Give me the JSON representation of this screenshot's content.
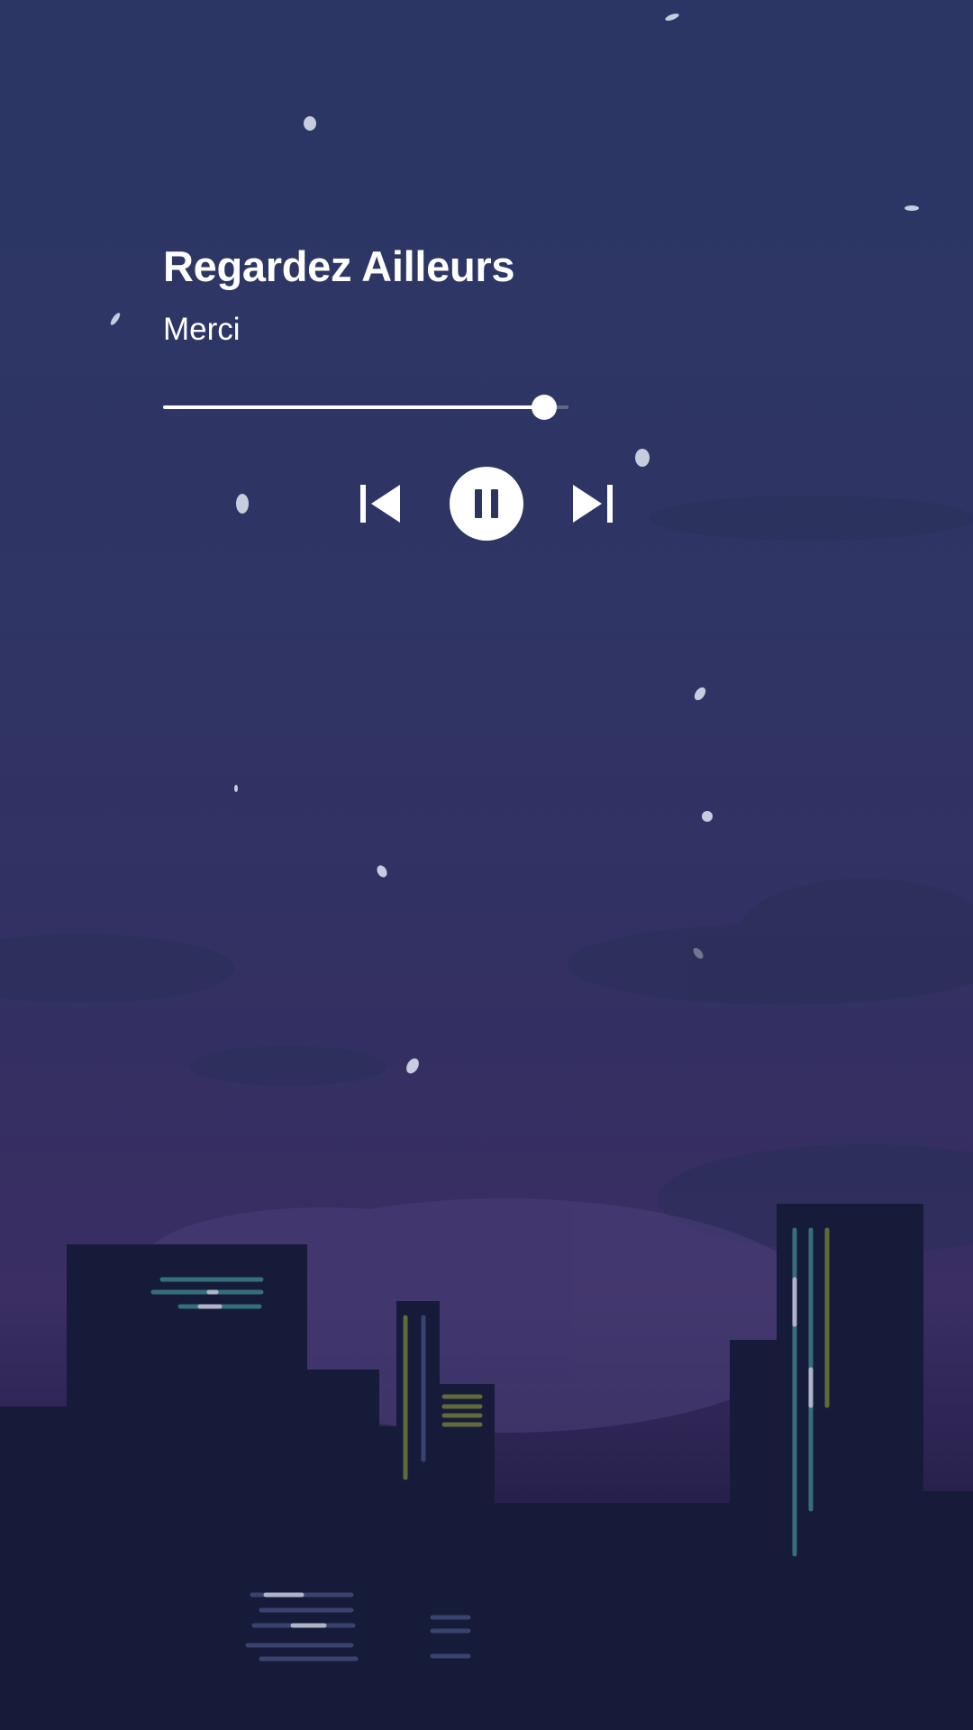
{
  "track": {
    "title": "Regardez Ailleurs",
    "artist": "Merci"
  },
  "playback": {
    "progress_fraction": 0.94,
    "state": "playing"
  },
  "controls": {
    "previous_icon": "skip-previous-icon",
    "pause_icon": "pause-icon",
    "next_icon": "skip-next-icon"
  },
  "colors": {
    "sky_top": "#2b3664",
    "sky_bottom": "#3a2e63",
    "buildings": "#161b3a",
    "controls": "#ffffff"
  }
}
